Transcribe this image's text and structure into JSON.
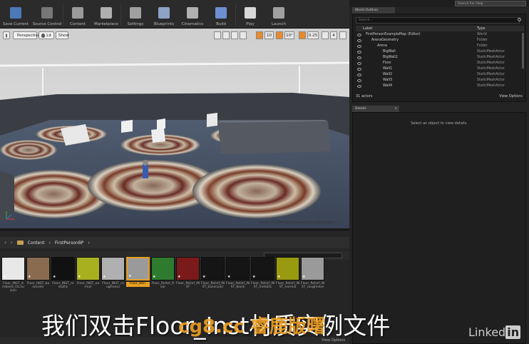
{
  "toolbar": {
    "buttons": [
      {
        "label": "Save Current",
        "icon": "save-icon",
        "color": "#4a7ab8"
      },
      {
        "label": "Source Control",
        "icon": "source-control-icon",
        "color": "#777777"
      },
      {
        "label": "Content",
        "icon": "content-icon",
        "color": "#9a9a9a"
      },
      {
        "label": "Marketplace",
        "icon": "marketplace-icon",
        "color": "#b0b0b0"
      },
      {
        "label": "Settings",
        "icon": "settings-icon",
        "color": "#a0a0a0"
      },
      {
        "label": "Blueprints",
        "icon": "blueprints-icon",
        "color": "#8fa3c8"
      },
      {
        "label": "Cinematics",
        "icon": "cinematics-icon",
        "color": "#b0b0b0"
      },
      {
        "label": "Build",
        "icon": "build-icon",
        "color": "#6c8fd0"
      },
      {
        "label": "Play",
        "icon": "play-icon",
        "color": "#d8d8d8"
      },
      {
        "label": "Launch",
        "icon": "launch-icon",
        "color": "#a0a0a0"
      }
    ]
  },
  "viewport": {
    "perspective_label": "Perspective",
    "lit_label": "Lit",
    "show_label": "Show",
    "grid_snap": "10",
    "rot_snap": "10°",
    "scale_snap": "0.25",
    "camera_speed": "4",
    "caption": "Level: FirstPersonExampleMap (Persistent)"
  },
  "content_browser": {
    "path_root": "Content",
    "path_folder": "FirstPersonBP",
    "view_options": "View Options",
    "assets": [
      {
        "label": "Floor_INST_Ambient_Occlusion",
        "color": "#e8e8e8",
        "selected": false
      },
      {
        "label": "Floor_INST_basecolor",
        "color": "#8a6b50",
        "selected": false
      },
      {
        "label": "Floor_INST_metallic",
        "color": "#111111",
        "selected": false
      },
      {
        "label": "Floor_INST_normal",
        "color": "#a8b020",
        "selected": false
      },
      {
        "label": "Floor_INST_roughness",
        "color": "#b0b0b0",
        "selected": false
      },
      {
        "label": "Floor_INST",
        "color": "#9a9a9a",
        "selected": true
      },
      {
        "label": "Floor_Relief_Floor",
        "color": "#2e7a2e",
        "selected": false
      },
      {
        "label": "Floor_Relief_INST",
        "color": "#7a1a1a",
        "selected": false
      },
      {
        "label": "Floor_Relief_INST_basecolor",
        "color": "#151515",
        "selected": false
      },
      {
        "label": "Floor_Relief_INST_block",
        "color": "#151515",
        "selected": false
      },
      {
        "label": "Floor_Relief_INST_metallic",
        "color": "#151515",
        "selected": false
      },
      {
        "label": "Floor_Relief_INST_normal",
        "color": "#9a9a10",
        "selected": false
      },
      {
        "label": "Floor_Relief_INST_roughness",
        "color": "#9a9a9a",
        "selected": false
      }
    ]
  },
  "outliner": {
    "tab": "World Outliner",
    "search_help": "Search For Help",
    "search_placeholder": "Search...",
    "col_label": "Label",
    "col_type": "Type",
    "rows": [
      {
        "name": "FirstPersonExampleMap (Editor)",
        "type": "World",
        "indent": 0
      },
      {
        "name": "ArenaGeometry",
        "type": "Folder",
        "indent": 1
      },
      {
        "name": "Arena",
        "type": "Folder",
        "indent": 2
      },
      {
        "name": "BigWall",
        "type": "StaticMeshActor",
        "indent": 3
      },
      {
        "name": "BigWall2",
        "type": "StaticMeshActor",
        "indent": 3
      },
      {
        "name": "Floor",
        "type": "StaticMeshActor",
        "indent": 3
      },
      {
        "name": "Wall1",
        "type": "StaticMeshActor",
        "indent": 3
      },
      {
        "name": "Wall2",
        "type": "StaticMeshActor",
        "indent": 3
      },
      {
        "name": "Wall3",
        "type": "StaticMeshActor",
        "indent": 3
      },
      {
        "name": "Wall4",
        "type": "StaticMeshActor",
        "indent": 3
      }
    ],
    "count": "31 actors",
    "view_options": "View Options"
  },
  "details": {
    "tab": "Details",
    "message": "Select an object to view details."
  },
  "subtitle": "我们双击Floor_Inst材质实例文件",
  "watermark": "cg8.cc 睿鹿版曙",
  "brand": "Linked",
  "brand_in": "in"
}
